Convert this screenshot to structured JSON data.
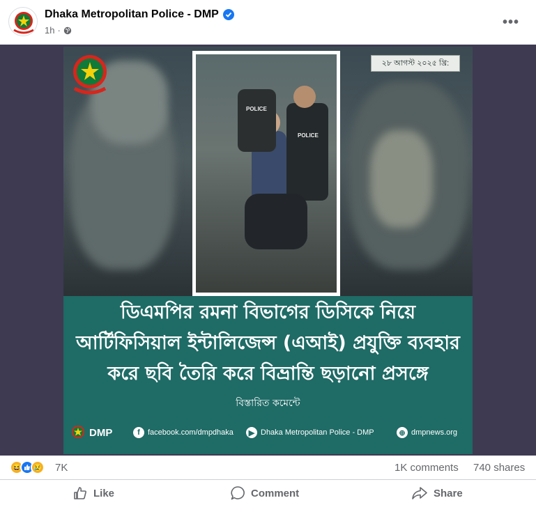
{
  "post": {
    "page_name": "Dhaka Metropolitan Police - DMP",
    "time": "1h",
    "separator": "·"
  },
  "poster": {
    "date": "২৮ আগস্ট ২০২৫ খ্রি:",
    "headline_lines": [
      "ডিএমপির রমনা বিভাগের ডিসিকে নিয়ে",
      "আর্টিফিসিয়াল ইন্টালিজেন্স (এআই) প্রযুক্তি ব্যবহার",
      "করে ছবি তৈরি করে বিভ্রান্তি ছড়ানো প্রসঙ্গে"
    ],
    "subline": "বিস্তারিত কমেন্টে",
    "footer": {
      "brand": "DMP",
      "facebook": "facebook.com/dmpdhaka",
      "youtube": "Dhaka Metropolitan Police - DMP",
      "web": "dmpnews.org"
    },
    "photo_labels": [
      "POLICE",
      "POLICE"
    ]
  },
  "stats": {
    "reactions_count": "7K",
    "comments": "1K comments",
    "shares": "740 shares"
  },
  "actions": {
    "like": "Like",
    "comment": "Comment",
    "share": "Share"
  },
  "colors": {
    "poster_bg": "#1f6b66",
    "frame_bg": "#3e3a52",
    "verified": "#1877f2",
    "meta_text": "#65676b"
  }
}
